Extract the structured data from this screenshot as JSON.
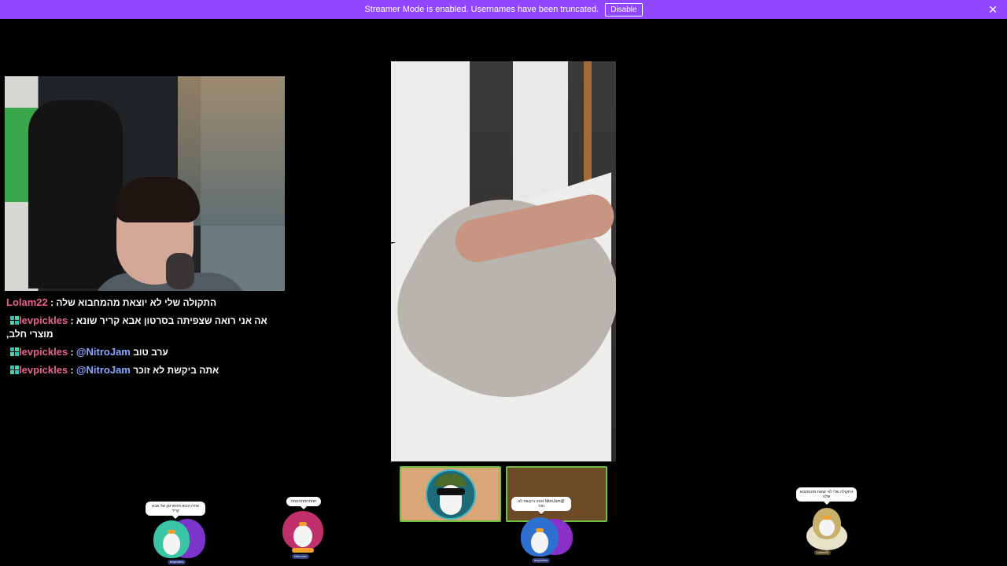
{
  "banner": {
    "message": "Streamer Mode is enabled. Usernames have been truncated.",
    "disable_label": "Disable",
    "close_glyph": "✕",
    "color": "#9147ff"
  },
  "chat": {
    "messages": [
      {
        "user": "Lolam22",
        "separator": " : ",
        "text": "התקולה שלי לא יוצאת מהמחבוא שלה"
      },
      {
        "user": "levpickles",
        "separator": " : ",
        "text": "אה אני רואה שצפיתה בסרטון אבא קריר שונא מוצרי חלב,",
        "badge": "badge-icon"
      },
      {
        "user": "levpickles",
        "separator": " : ",
        "mention": "@NitroJam",
        "text": "ערב טוב",
        "badge": "badge-icon"
      },
      {
        "user": "levpickles",
        "separator": " : ",
        "mention": "@NitroJam",
        "text": "אתה ביקשת לא זוכר",
        "badge": "badge-icon"
      }
    ],
    "user_color": "#e8628a",
    "mention_color": "#8aa6ff"
  },
  "speech_bubbles": {
    "left": "אתה הבוא מהסרטון של אבא קריר",
    "mid_left": "חחחחחחחחחח",
    "center": "@NitroJam אתה ביקשת לא זוכר",
    "right": "התקולה שלי לא יוצאת מהמחבוא שלה"
  },
  "name_tags": {
    "left": "levpickles",
    "mid_left": "NitroJam",
    "center": "levpickles",
    "right": "Lolam22"
  }
}
